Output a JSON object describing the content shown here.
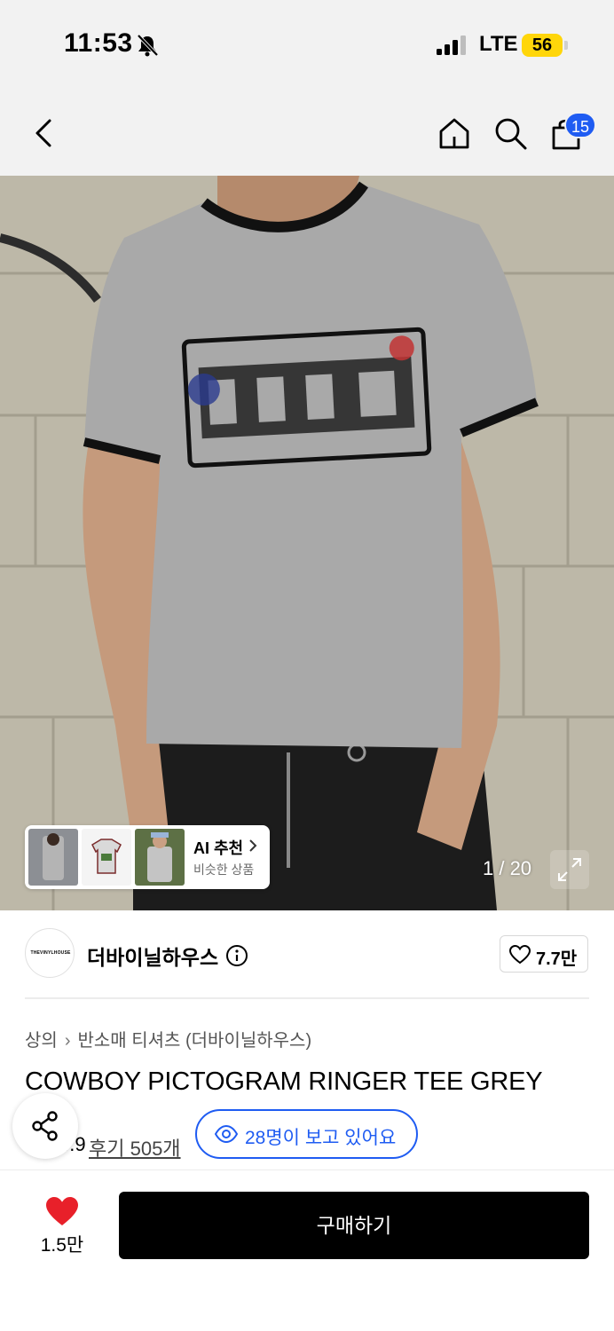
{
  "status_bar": {
    "time": "11:53",
    "network": "LTE",
    "battery": "56"
  },
  "nav": {
    "cart_count": "15"
  },
  "gallery": {
    "ai_recommend_title": "AI 추천",
    "ai_recommend_subtitle": "비슷한 상품",
    "counter": "1 / 20"
  },
  "brand": {
    "logo_text": "THEVINYLHOUSE",
    "name": "더바이닐하우스",
    "likes": "7.7만"
  },
  "breadcrumb": {
    "category": "상의",
    "subcategory": "반소매 티셔츠 (더바이닐하우스)"
  },
  "product": {
    "title": "COWBOY PICTOGRAM RINGER TEE GREY",
    "rating": "4.9",
    "reviews": "후기 505개",
    "viewers": "28명이 보고 있어요"
  },
  "bottom_bar": {
    "wish_count": "1.5만",
    "buy_label": "구매하기"
  },
  "colors": {
    "accent_blue": "#1f5cf2",
    "heart_red": "#e8202a",
    "battery_yellow": "#ffd60a",
    "buy_black": "#000000"
  },
  "icons": [
    "bell-muted-icon",
    "signal-icon",
    "back-icon",
    "home-icon",
    "search-icon",
    "bag-icon",
    "expand-icon",
    "info-icon",
    "heart-outline-icon",
    "star-icon",
    "share-icon",
    "eye-icon",
    "heart-filled-icon",
    "chevron-right-icon"
  ]
}
